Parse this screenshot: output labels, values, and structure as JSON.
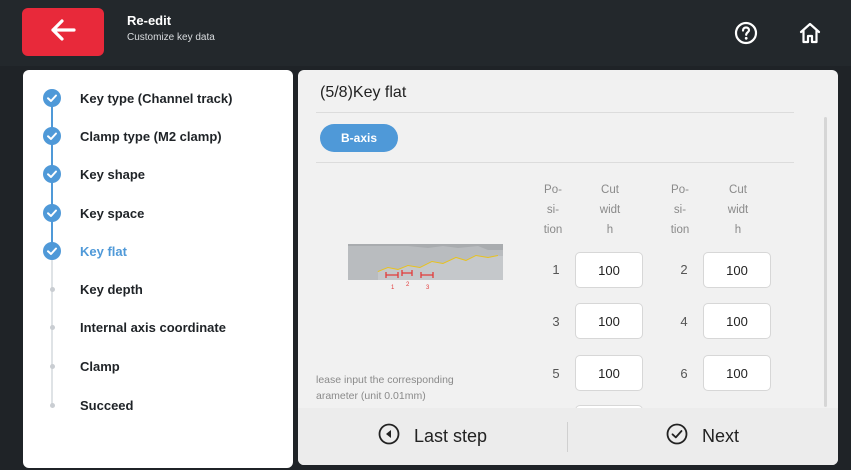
{
  "header": {
    "title": "Re-edit",
    "subtitle": "Customize key data",
    "back_icon": "arrow-left-icon",
    "help_icon": "question-circle-icon",
    "home_icon": "home-icon",
    "back_color": "#e8293a"
  },
  "sidebar": {
    "steps": [
      {
        "label": "Key type (Channel track)",
        "state": "done"
      },
      {
        "label": "Clamp type (M2 clamp)",
        "state": "done"
      },
      {
        "label": "Key shape",
        "state": "done"
      },
      {
        "label": "Key space",
        "state": "done"
      },
      {
        "label": "Key flat",
        "state": "current"
      },
      {
        "label": "Key depth",
        "state": "pending"
      },
      {
        "label": "Internal axis coordinate",
        "state": "pending"
      },
      {
        "label": "Clamp",
        "state": "pending"
      },
      {
        "label": "Succeed",
        "state": "pending"
      }
    ],
    "accent": "#4f99d8"
  },
  "main": {
    "title": "(5/8)Key flat",
    "axis_button": "B-axis",
    "hint_line1": "lease input the corresponding",
    "hint_line2": "arameter (unit 0.01mm)",
    "col_position": [
      "Po-",
      "si-",
      "tion"
    ],
    "col_cutwidth": [
      "Cut",
      "widt",
      "h"
    ],
    "rows": [
      {
        "p1": "1",
        "v1": "100",
        "p2": "2",
        "v2": "100"
      },
      {
        "p1": "3",
        "v1": "100",
        "p2": "4",
        "v2": "100"
      },
      {
        "p1": "5",
        "v1": "100",
        "p2": "6",
        "v2": "100"
      }
    ],
    "key_marks": [
      "1",
      "2",
      "3"
    ]
  },
  "footer": {
    "last_step": "Last step",
    "next": "Next"
  }
}
